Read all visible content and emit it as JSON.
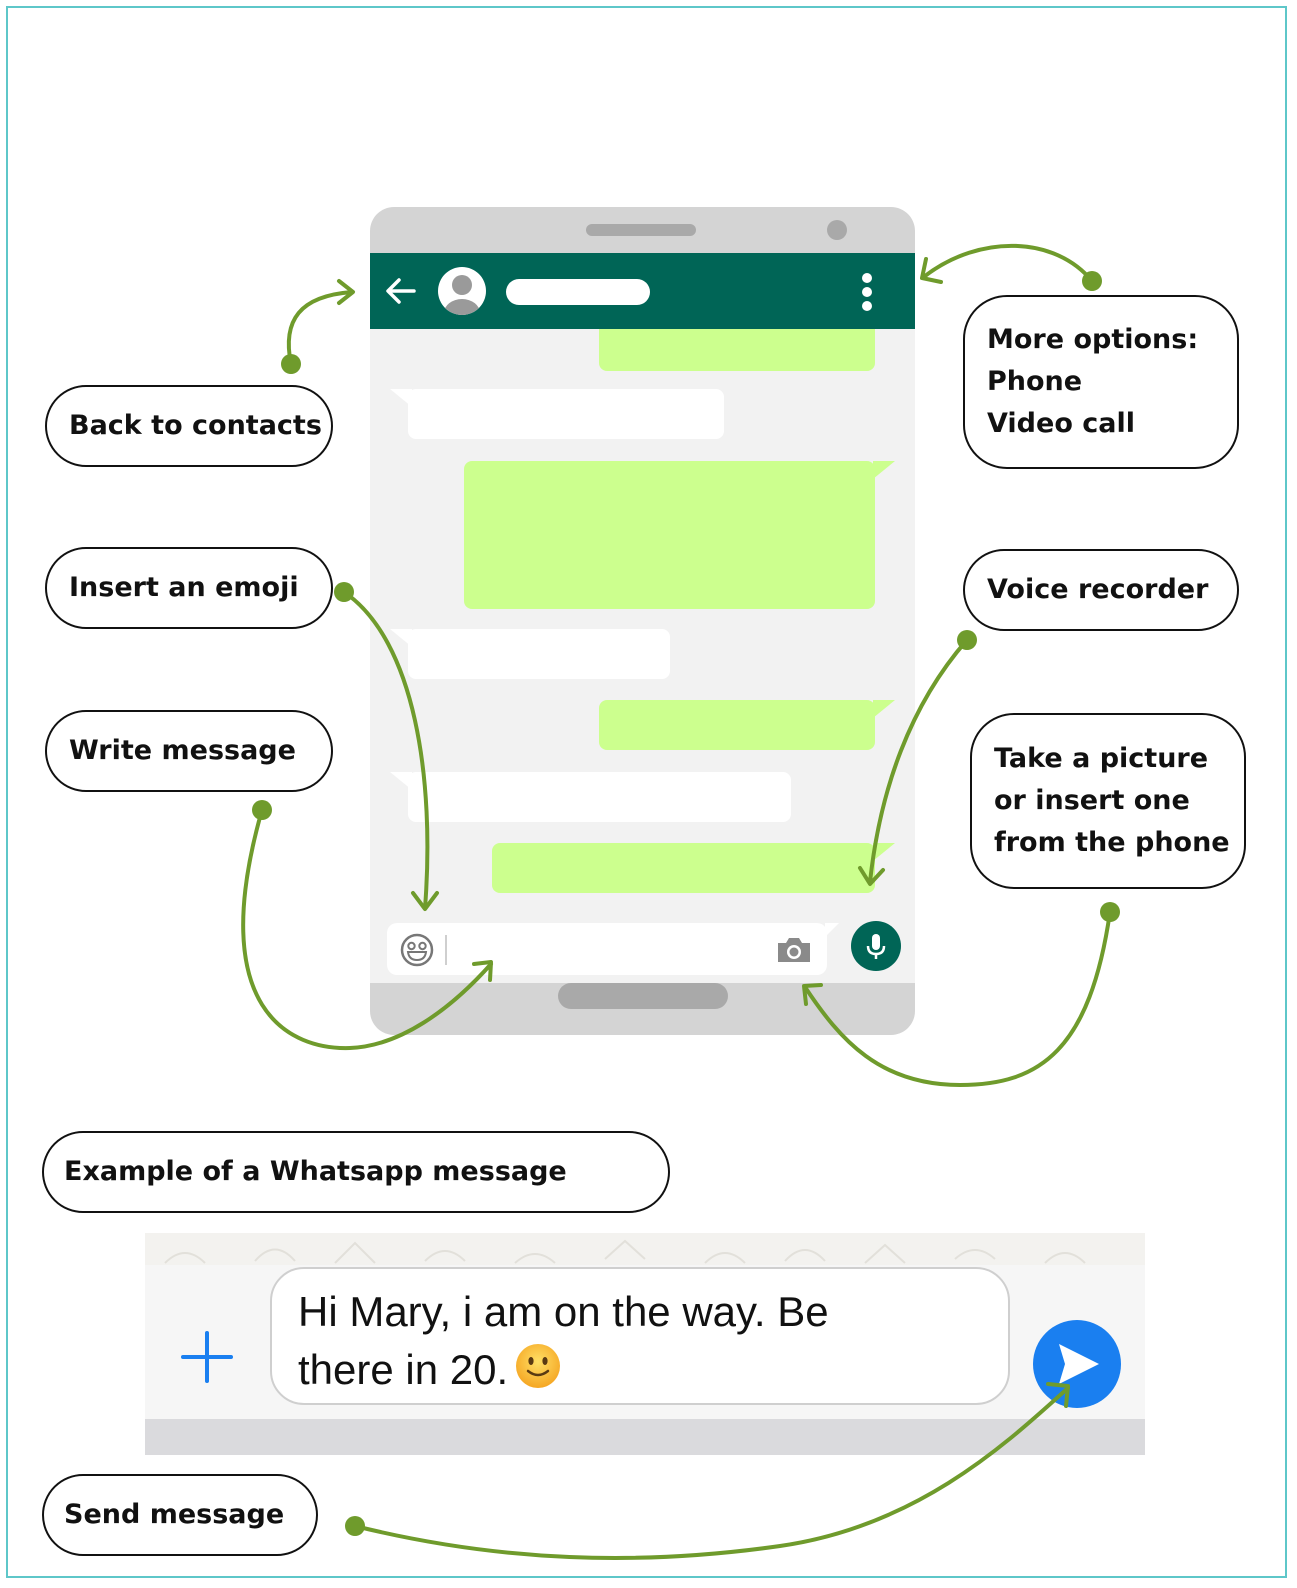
{
  "callouts": {
    "back": "Back to contacts",
    "more_options": [
      "More options:",
      "Phone",
      "Video call"
    ],
    "emoji": "Insert an emoji",
    "voice": "Voice recorder",
    "write": "Write message",
    "picture": [
      "Take a picture",
      "or insert one",
      "from the phone"
    ],
    "example_title": "Example of a Whatsapp message",
    "send": "Send message"
  },
  "example_message": {
    "line1": "Hi Mary, i am on the way. Be",
    "line2": "there in 20."
  },
  "icons": [
    "back-arrow-icon",
    "avatar-icon",
    "more-options-icon",
    "emoji-icon",
    "camera-icon",
    "microphone-icon",
    "plus-icon",
    "sticker-icon",
    "send-icon",
    "smiley-emoji"
  ],
  "colors": {
    "border": "#5ec7c9",
    "whatsapp_green": "#006556",
    "outgoing_bubble": "#ccff8e",
    "arrow": "#6f9b2c",
    "send_blue": "#1a7ff0"
  }
}
